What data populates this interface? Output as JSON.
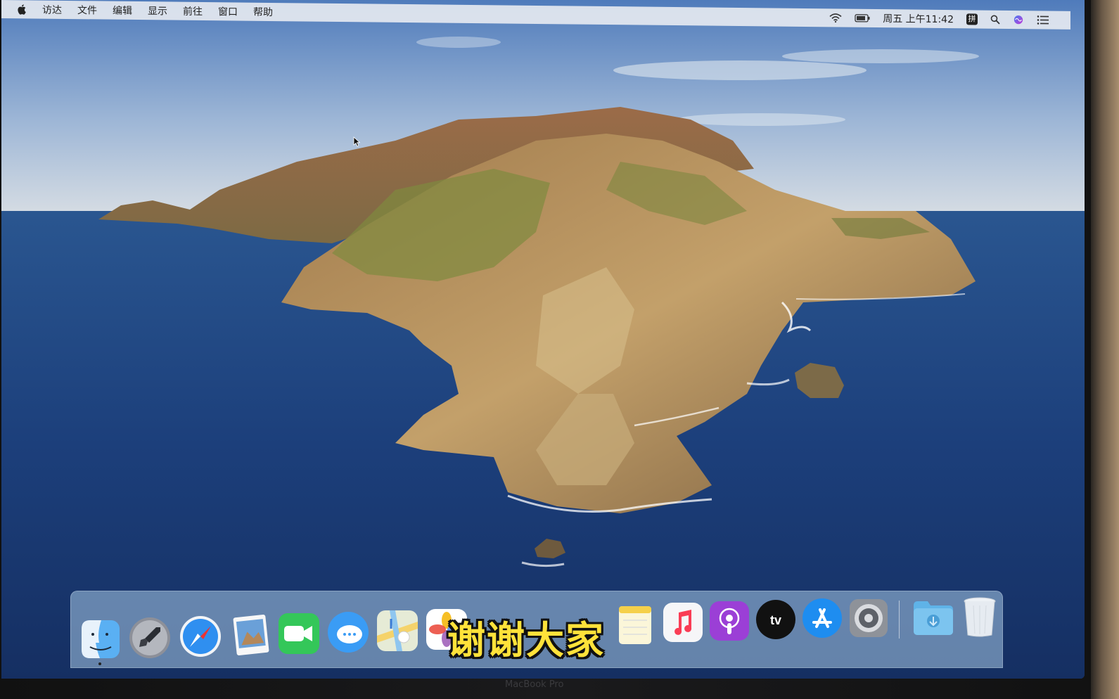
{
  "menubar": {
    "items": [
      "访达",
      "文件",
      "编辑",
      "显示",
      "前往",
      "窗口",
      "帮助"
    ],
    "clock": "周五 上午11:42",
    "input_method": "拼"
  },
  "dock": {
    "apps": [
      {
        "name": "Finder",
        "icon": "finder-icon"
      },
      {
        "name": "Launchpad",
        "icon": "launchpad-icon"
      },
      {
        "name": "Safari",
        "icon": "safari-icon"
      },
      {
        "name": "Preview",
        "icon": "preview-icon"
      },
      {
        "name": "FaceTime",
        "icon": "facetime-icon"
      },
      {
        "name": "Messages",
        "icon": "messages-icon"
      },
      {
        "name": "Maps",
        "icon": "maps-icon"
      },
      {
        "name": "Photos",
        "icon": "photos-icon"
      },
      {
        "name": "Notes",
        "icon": "notes-icon"
      },
      {
        "name": "Music",
        "icon": "music-icon"
      },
      {
        "name": "Podcasts",
        "icon": "podcasts-icon"
      },
      {
        "name": "TV",
        "icon": "tv-icon"
      },
      {
        "name": "App Store",
        "icon": "app-store-icon"
      },
      {
        "name": "System Preferences",
        "icon": "system-preferences-icon"
      },
      {
        "name": "Downloads",
        "icon": "downloads-folder-icon"
      },
      {
        "name": "Trash",
        "icon": "trash-icon"
      }
    ],
    "tv_label": "tv"
  },
  "subtitle": "谢谢大家",
  "bezel_label": "MacBook Pro",
  "colors": {
    "sky_top": "#5d86c2",
    "sky_horizon": "#cfd9e4",
    "sea": "#1b3f7a",
    "subtitle_fill": "#ffe23a"
  }
}
